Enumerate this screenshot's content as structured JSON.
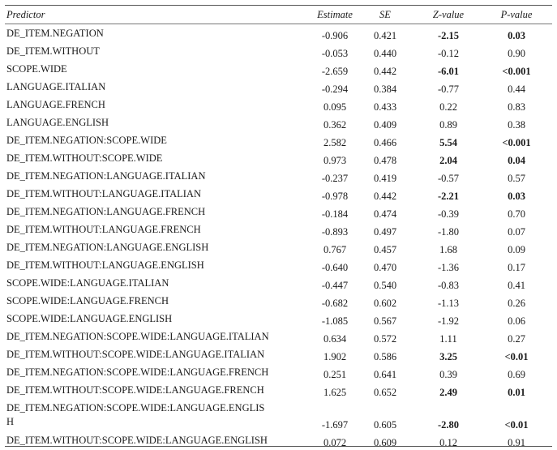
{
  "table": {
    "headers": {
      "predictor": "Predictor",
      "estimate": "Estimate",
      "se": "SE",
      "z": "Z-value",
      "p": "P-value"
    },
    "rows": [
      {
        "predictor": "DE_ITEM.NEGATION",
        "estimate": "-0.906",
        "se": "0.421",
        "z": "-2.15",
        "p": "0.03",
        "significant": true
      },
      {
        "predictor": "DE_ITEM.WITHOUT",
        "estimate": "-0.053",
        "se": "0.440",
        "z": "-0.12",
        "p": "0.90",
        "significant": false
      },
      {
        "predictor": "SCOPE.WIDE",
        "estimate": "-2.659",
        "se": "0.442",
        "z": "-6.01",
        "p": "<0.001",
        "significant": true
      },
      {
        "predictor": "LANGUAGE.ITALIAN",
        "estimate": "-0.294",
        "se": "0.384",
        "z": "-0.77",
        "p": "0.44",
        "significant": false
      },
      {
        "predictor": "LANGUAGE.FRENCH",
        "estimate": "0.095",
        "se": "0.433",
        "z": "0.22",
        "p": "0.83",
        "significant": false
      },
      {
        "predictor": "LANGUAGE.ENGLISH",
        "estimate": "0.362",
        "se": "0.409",
        "z": "0.89",
        "p": "0.38",
        "significant": false
      },
      {
        "predictor": "DE_ITEM.NEGATION:SCOPE.WIDE",
        "estimate": "2.582",
        "se": "0.466",
        "z": "5.54",
        "p": "<0.001",
        "significant": true
      },
      {
        "predictor": "DE_ITEM.WITHOUT:SCOPE.WIDE",
        "estimate": "0.973",
        "se": "0.478",
        "z": "2.04",
        "p": "0.04",
        "significant": true
      },
      {
        "predictor": "DE_ITEM.NEGATION:LANGUAGE.ITALIAN",
        "estimate": "-0.237",
        "se": "0.419",
        "z": "-0.57",
        "p": "0.57",
        "significant": false
      },
      {
        "predictor": "DE_ITEM.WITHOUT:LANGUAGE.ITALIAN",
        "estimate": "-0.978",
        "se": "0.442",
        "z": "-2.21",
        "p": "0.03",
        "significant": true
      },
      {
        "predictor": "DE_ITEM.NEGATION:LANGUAGE.FRENCH",
        "estimate": "-0.184",
        "se": "0.474",
        "z": "-0.39",
        "p": "0.70",
        "significant": false
      },
      {
        "predictor": "DE_ITEM.WITHOUT:LANGUAGE.FRENCH",
        "estimate": "-0.893",
        "se": "0.497",
        "z": "-1.80",
        "p": "0.07",
        "significant": false
      },
      {
        "predictor": "DE_ITEM.NEGATION:LANGUAGE.ENGLISH",
        "estimate": "0.767",
        "se": "0.457",
        "z": "1.68",
        "p": "0.09",
        "significant": false
      },
      {
        "predictor": "DE_ITEM.WITHOUT:LANGUAGE.ENGLISH",
        "estimate": "-0.640",
        "se": "0.470",
        "z": "-1.36",
        "p": "0.17",
        "significant": false
      },
      {
        "predictor": "SCOPE.WIDE:LANGUAGE.ITALIAN",
        "estimate": "-0.447",
        "se": "0.540",
        "z": "-0.83",
        "p": "0.41",
        "significant": false
      },
      {
        "predictor": "SCOPE.WIDE:LANGUAGE.FRENCH",
        "estimate": "-0.682",
        "se": "0.602",
        "z": "-1.13",
        "p": "0.26",
        "significant": false
      },
      {
        "predictor": "SCOPE.WIDE:LANGUAGE.ENGLISH",
        "estimate": "-1.085",
        "se": "0.567",
        "z": "-1.92",
        "p": "0.06",
        "significant": false
      },
      {
        "predictor": "DE_ITEM.NEGATION:SCOPE.WIDE:LANGUAGE.ITALIAN",
        "estimate": "0.634",
        "se": "0.572",
        "z": "1.11",
        "p": "0.27",
        "significant": false
      },
      {
        "predictor": "DE_ITEM.WITHOUT:SCOPE.WIDE:LANGUAGE.ITALIAN",
        "estimate": "1.902",
        "se": "0.586",
        "z": "3.25",
        "p": "<0.01",
        "significant": true
      },
      {
        "predictor": "DE_ITEM.NEGATION:SCOPE.WIDE:LANGUAGE.FRENCH",
        "estimate": "0.251",
        "se": "0.641",
        "z": "0.39",
        "p": "0.69",
        "significant": false
      },
      {
        "predictor": "DE_ITEM.WITHOUT:SCOPE.WIDE:LANGUAGE.FRENCH",
        "estimate": "1.625",
        "se": "0.652",
        "z": "2.49",
        "p": "0.01",
        "significant": true
      },
      {
        "predictor": "DE_ITEM.NEGATION:SCOPE.WIDE:LANGUAGE.ENGLIS\nH",
        "estimate": "-1.697",
        "se": "0.605",
        "z": "-2.80",
        "p": "<0.01",
        "significant": true,
        "wrapped": true
      },
      {
        "predictor": "DE_ITEM.WITHOUT:SCOPE.WIDE:LANGUAGE.ENGLISH",
        "estimate": "0.072",
        "se": "0.609",
        "z": "0.12",
        "p": "0.91",
        "significant": false
      }
    ]
  }
}
